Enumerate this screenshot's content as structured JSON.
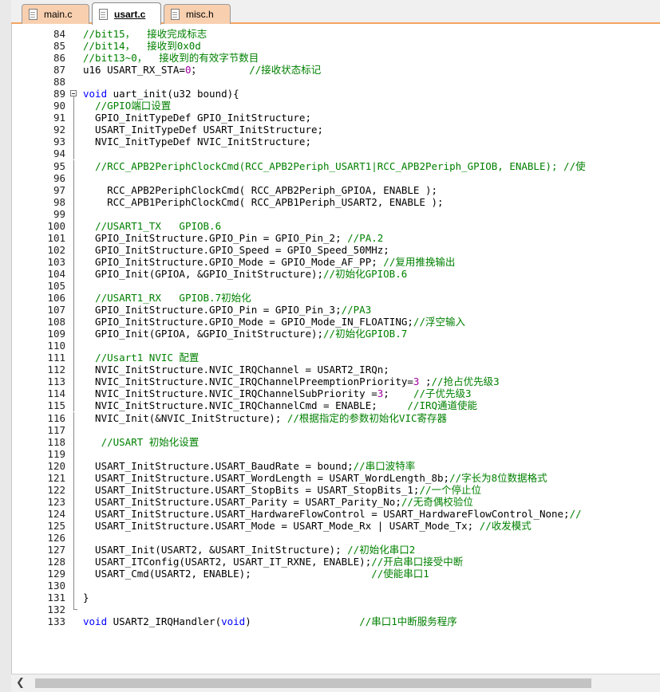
{
  "tabs": [
    {
      "label": "main.c",
      "active": false
    },
    {
      "label": "usart.c",
      "active": true
    },
    {
      "label": "misc.h",
      "active": false
    }
  ],
  "lines": [
    {
      "n": "84",
      "t": [
        [
          "cm",
          "//bit15，  接收完成标志"
        ]
      ]
    },
    {
      "n": "85",
      "t": [
        [
          "cm",
          "//bit14，  接收到0x0d"
        ]
      ]
    },
    {
      "n": "86",
      "t": [
        [
          "cm",
          "//bit13~0，  接收到的有效字节数目"
        ]
      ]
    },
    {
      "n": "87",
      "t": [
        [
          "",
          "u16 USART_RX_STA="
        ],
        [
          "num",
          "0"
        ],
        [
          "",
          "；        "
        ],
        [
          "cm",
          "//接收状态标记"
        ]
      ]
    },
    {
      "n": "88",
      "t": []
    },
    {
      "n": "89",
      "fold": "start",
      "t": [
        [
          "kw",
          "void"
        ],
        [
          "",
          " uart_init(u32 bound){"
        ]
      ]
    },
    {
      "n": "90",
      "fold": "v",
      "t": [
        [
          "",
          "  "
        ],
        [
          "cm",
          "//GPIO端口设置"
        ]
      ]
    },
    {
      "n": "91",
      "fold": "v",
      "t": [
        [
          "",
          "  GPIO_InitTypeDef GPIO_InitStructure;"
        ]
      ]
    },
    {
      "n": "92",
      "fold": "v",
      "t": [
        [
          "",
          "  USART_InitTypeDef USART_InitStructure;"
        ]
      ]
    },
    {
      "n": "93",
      "fold": "v",
      "t": [
        [
          "",
          "  NVIC_InitTypeDef NVIC_InitStructure;"
        ]
      ]
    },
    {
      "n": "94",
      "fold": "v",
      "t": []
    },
    {
      "n": "95",
      "fold": "v",
      "t": [
        [
          "",
          "  "
        ],
        [
          "cm",
          "//RCC_APB2PeriphClockCmd(RCC_APB2Periph_USART1|RCC_APB2Periph_GPIOB, ENABLE); //使"
        ]
      ]
    },
    {
      "n": "96",
      "fold": "v",
      "t": []
    },
    {
      "n": "97",
      "fold": "v",
      "t": [
        [
          "",
          "    RCC_APB2PeriphClockCmd( RCC_APB2Periph_GPIOA, ENABLE );"
        ]
      ]
    },
    {
      "n": "98",
      "fold": "v",
      "t": [
        [
          "",
          "    RCC_APB1PeriphClockCmd( RCC_APB1Periph_USART2, ENABLE );"
        ]
      ]
    },
    {
      "n": "99",
      "fold": "v",
      "t": []
    },
    {
      "n": "100",
      "fold": "v",
      "t": [
        [
          "",
          "  "
        ],
        [
          "cm",
          "//USART1_TX   GPIOB.6"
        ]
      ]
    },
    {
      "n": "101",
      "fold": "v",
      "t": [
        [
          "",
          "  GPIO_InitStructure.GPIO_Pin = GPIO_Pin_2; "
        ],
        [
          "cm",
          "//PA.2"
        ]
      ]
    },
    {
      "n": "102",
      "fold": "v",
      "t": [
        [
          "",
          "  GPIO_InitStructure.GPIO_Speed = GPIO_Speed_50MHz;"
        ]
      ]
    },
    {
      "n": "103",
      "fold": "v",
      "t": [
        [
          "",
          "  GPIO_InitStructure.GPIO_Mode = GPIO_Mode_AF_PP; "
        ],
        [
          "cm",
          "//复用推挽输出"
        ]
      ]
    },
    {
      "n": "104",
      "fold": "v",
      "t": [
        [
          "",
          "  GPIO_Init(GPIOA, &GPIO_InitStructure);"
        ],
        [
          "cm",
          "//初始化GPIOB.6"
        ]
      ]
    },
    {
      "n": "105",
      "fold": "v",
      "t": []
    },
    {
      "n": "106",
      "fold": "v",
      "t": [
        [
          "",
          "  "
        ],
        [
          "cm",
          "//USART1_RX   GPIOB.7初始化"
        ]
      ]
    },
    {
      "n": "107",
      "fold": "v",
      "t": [
        [
          "",
          "  GPIO_InitStructure.GPIO_Pin = GPIO_Pin_3;"
        ],
        [
          "cm",
          "//PA3"
        ]
      ]
    },
    {
      "n": "108",
      "fold": "v",
      "t": [
        [
          "",
          "  GPIO_InitStructure.GPIO_Mode = GPIO_Mode_IN_FLOATING;"
        ],
        [
          "cm",
          "//浮空输入"
        ]
      ]
    },
    {
      "n": "109",
      "fold": "v",
      "t": [
        [
          "",
          "  GPIO_Init(GPIOA, &GPIO_InitStructure);"
        ],
        [
          "cm",
          "//初始化GPIOB.7"
        ]
      ]
    },
    {
      "n": "110",
      "fold": "v",
      "t": []
    },
    {
      "n": "111",
      "fold": "v",
      "t": [
        [
          "",
          "  "
        ],
        [
          "cm",
          "//Usart1 NVIC 配置"
        ]
      ]
    },
    {
      "n": "112",
      "fold": "v",
      "t": [
        [
          "",
          "  NVIC_InitStructure.NVIC_IRQChannel = USART2_IRQn;"
        ]
      ]
    },
    {
      "n": "113",
      "fold": "v",
      "t": [
        [
          "",
          "  NVIC_InitStructure.NVIC_IRQChannelPreemptionPriority="
        ],
        [
          "num",
          "3"
        ],
        [
          "",
          " ;"
        ],
        [
          "cm",
          "//抢占优先级3"
        ]
      ]
    },
    {
      "n": "114",
      "fold": "v",
      "t": [
        [
          "",
          "  NVIC_InitStructure.NVIC_IRQChannelSubPriority ="
        ],
        [
          "num",
          "3"
        ],
        [
          "",
          ";    "
        ],
        [
          "cm",
          "//子优先级3"
        ]
      ]
    },
    {
      "n": "115",
      "fold": "v",
      "t": [
        [
          "",
          "  NVIC_InitStructure.NVIC_IRQChannelCmd = ENABLE;     "
        ],
        [
          "cm",
          "//IRQ通道使能"
        ]
      ]
    },
    {
      "n": "116",
      "fold": "v",
      "t": [
        [
          "",
          "  NVIC_Init(&NVIC_InitStructure); "
        ],
        [
          "cm",
          "//根据指定的参数初始化VIC寄存器"
        ]
      ]
    },
    {
      "n": "117",
      "fold": "v",
      "t": []
    },
    {
      "n": "118",
      "fold": "v",
      "t": [
        [
          "",
          "   "
        ],
        [
          "cm",
          "//USART 初始化设置"
        ]
      ]
    },
    {
      "n": "119",
      "fold": "v",
      "t": []
    },
    {
      "n": "120",
      "fold": "v",
      "t": [
        [
          "",
          "  USART_InitStructure.USART_BaudRate = bound;"
        ],
        [
          "cm",
          "//串口波特率"
        ]
      ]
    },
    {
      "n": "121",
      "fold": "v",
      "t": [
        [
          "",
          "  USART_InitStructure.USART_WordLength = USART_WordLength_8b;"
        ],
        [
          "cm",
          "//字长为8位数据格式"
        ]
      ]
    },
    {
      "n": "122",
      "fold": "v",
      "t": [
        [
          "",
          "  USART_InitStructure.USART_StopBits = USART_StopBits_1;"
        ],
        [
          "cm",
          "//一个停止位"
        ]
      ]
    },
    {
      "n": "123",
      "fold": "v",
      "t": [
        [
          "",
          "  USART_InitStructure.USART_Parity = USART_Parity_No;"
        ],
        [
          "cm",
          "//无奇偶校验位"
        ]
      ]
    },
    {
      "n": "124",
      "fold": "v",
      "t": [
        [
          "",
          "  USART_InitStructure.USART_HardwareFlowControl = USART_HardwareFlowControl_None;"
        ],
        [
          "cm",
          "//"
        ]
      ]
    },
    {
      "n": "125",
      "fold": "v",
      "t": [
        [
          "",
          "  USART_InitStructure.USART_Mode = USART_Mode_Rx | USART_Mode_Tx; "
        ],
        [
          "cm",
          "//收发模式"
        ]
      ]
    },
    {
      "n": "126",
      "fold": "v",
      "t": []
    },
    {
      "n": "127",
      "fold": "v",
      "t": [
        [
          "",
          "  USART_Init(USART2, &USART_InitStructure); "
        ],
        [
          "cm",
          "//初始化串口2"
        ]
      ]
    },
    {
      "n": "128",
      "fold": "v",
      "t": [
        [
          "",
          "  USART_ITConfig(USART2, USART_IT_RXNE, ENABLE);"
        ],
        [
          "cm",
          "//开启串口接受中断"
        ]
      ]
    },
    {
      "n": "129",
      "fold": "v",
      "t": [
        [
          "",
          "  USART_Cmd(USART2, ENABLE);                    "
        ],
        [
          "cm",
          "//使能串口1"
        ]
      ]
    },
    {
      "n": "130",
      "fold": "v",
      "t": []
    },
    {
      "n": "131",
      "fold": "v",
      "t": [
        [
          "",
          "}"
        ]
      ]
    },
    {
      "n": "132",
      "fold": "end",
      "t": []
    },
    {
      "n": "133",
      "t": [
        [
          "kw",
          "void"
        ],
        [
          "",
          " USART2_IRQHandler("
        ],
        [
          "kw",
          "void"
        ],
        [
          "",
          ")                  "
        ],
        [
          "cm",
          "//串口1中断服务程序"
        ]
      ]
    }
  ]
}
